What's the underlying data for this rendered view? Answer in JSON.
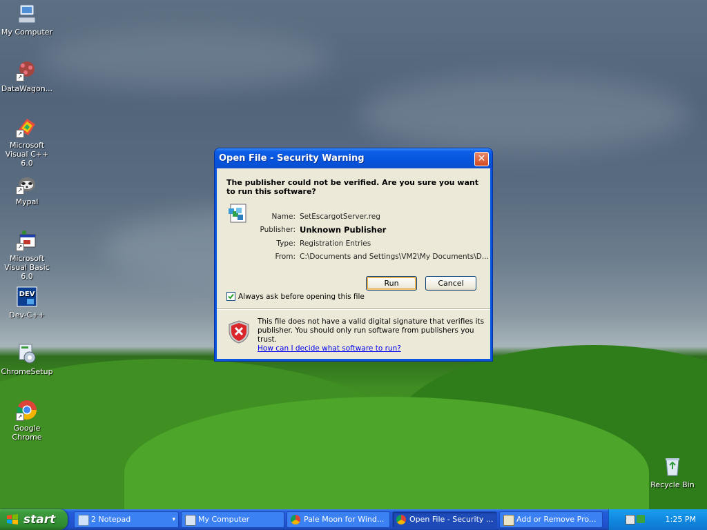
{
  "desktop": {
    "icons": [
      {
        "label": "My Computer"
      },
      {
        "label": "DataWagon..."
      },
      {
        "label": "Microsoft Visual C++ 6.0"
      },
      {
        "label": "Mypal"
      },
      {
        "label": "Microsoft Visual Basic 6.0"
      },
      {
        "label": "Dev-C++"
      },
      {
        "label": "ChromeSetup"
      },
      {
        "label": "Google Chrome"
      },
      {
        "label": "Recycle Bin"
      }
    ]
  },
  "dialog": {
    "title": "Open File - Security Warning",
    "close_glyph": "✕",
    "question": "The publisher could not be verified.  Are you sure you want to run this software?",
    "fields": {
      "name_label": "Name:",
      "name_value": "SetEscargotServer.reg",
      "publisher_label": "Publisher:",
      "publisher_value": "Unknown Publisher",
      "type_label": "Type:",
      "type_value": "Registration Entries",
      "from_label": "From:",
      "from_value": "C:\\Documents and Settings\\VM2\\My Documents\\D..."
    },
    "run_label": "Run",
    "cancel_label": "Cancel",
    "always_ask_label": "Always ask before opening this file",
    "always_ask_checked": true,
    "warning_text": "This file does not have a valid digital signature that verifies its publisher.  You should only run software from publishers you trust.",
    "warning_link": "How can I decide what software to run?"
  },
  "taskbar": {
    "start_label": "start",
    "tasks": [
      {
        "label": "2 Notepad",
        "icon": "notepad-icon"
      },
      {
        "label": "My Computer",
        "icon": "computer-icon"
      },
      {
        "label": "Pale Moon for Wind...",
        "icon": "chrome-icon"
      },
      {
        "label": "Open File - Security ...",
        "icon": "chrome-icon"
      },
      {
        "label": "Add or Remove Pro...",
        "icon": "add-remove-icon"
      }
    ],
    "clock": "1:25 PM"
  },
  "colors": {
    "titlebar_blue": "#0754dc",
    "taskbar_blue": "#245edb",
    "start_green": "#3c9b3c",
    "dialog_face": "#ece9d8"
  }
}
